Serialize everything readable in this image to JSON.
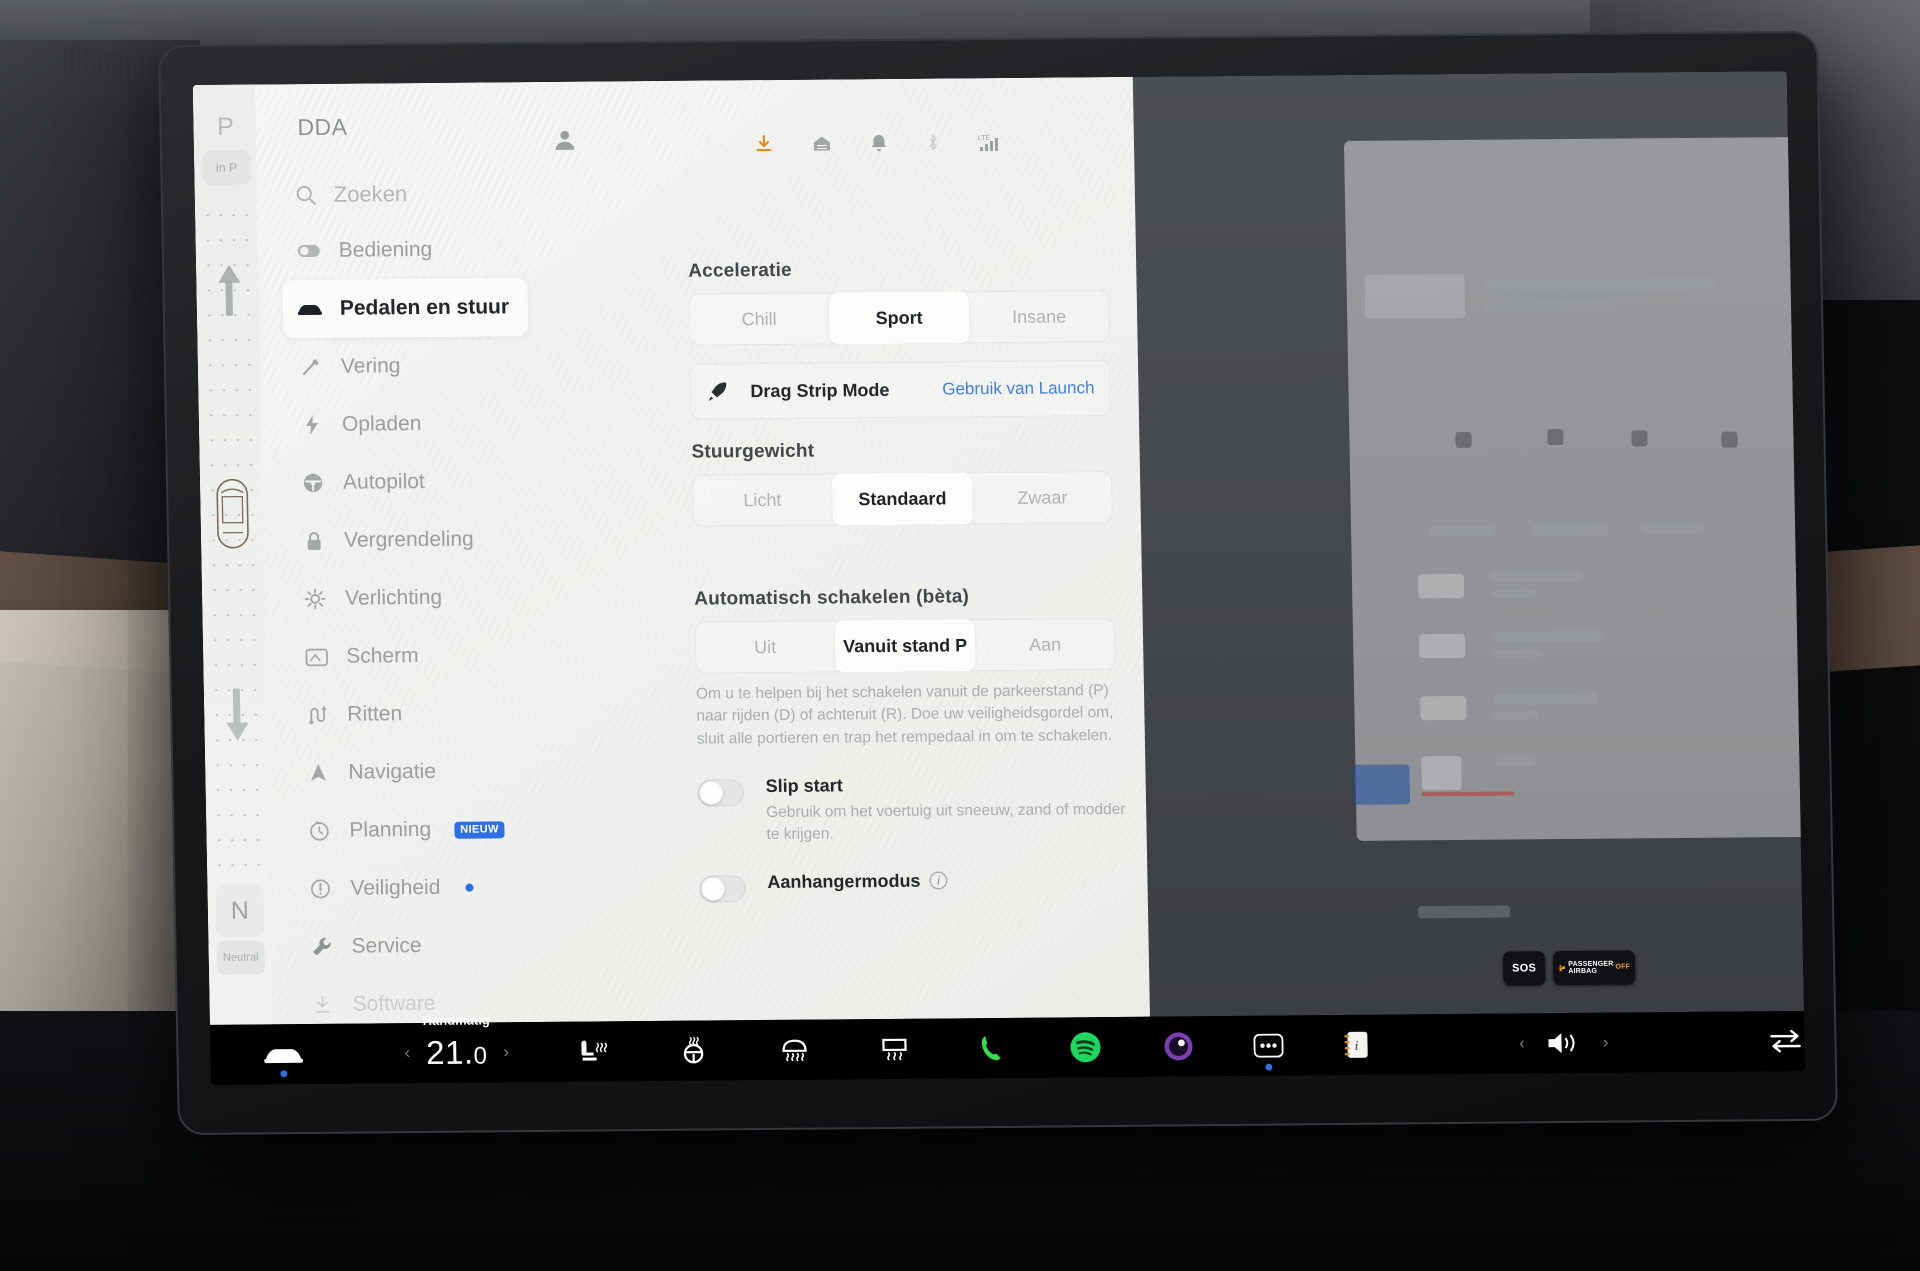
{
  "gear_selector": {
    "park_label": "P",
    "in_park_label": "In P",
    "neutral_label": "N",
    "neutral_sub_label": "Neutral"
  },
  "header": {
    "vehicle_name": "DDA",
    "profile_icon": "profile-icon",
    "status_icons": [
      "download-icon",
      "garage-icon",
      "bell-icon",
      "bluetooth-icon",
      "lte-signal-icon"
    ],
    "lte_label": "LTE"
  },
  "nav": {
    "search_placeholder": "Zoeken",
    "items": [
      {
        "label": "Bediening",
        "icon": "toggle-icon",
        "active": false
      },
      {
        "label": "Pedalen en stuur",
        "icon": "car-front-icon",
        "active": true
      },
      {
        "label": "Vering",
        "icon": "suspension-icon",
        "active": false
      },
      {
        "label": "Opladen",
        "icon": "bolt-icon",
        "active": false
      },
      {
        "label": "Autopilot",
        "icon": "steering-icon",
        "active": false
      },
      {
        "label": "Vergrendeling",
        "icon": "lock-icon",
        "active": false
      },
      {
        "label": "Verlichting",
        "icon": "sun-icon",
        "active": false
      },
      {
        "label": "Scherm",
        "icon": "display-icon",
        "active": false
      },
      {
        "label": "Ritten",
        "icon": "trips-icon",
        "active": false
      },
      {
        "label": "Navigatie",
        "icon": "navigation-icon",
        "active": false
      },
      {
        "label": "Planning",
        "icon": "clock-icon",
        "active": false,
        "badge": "NIEUW"
      },
      {
        "label": "Veiligheid",
        "icon": "alert-icon",
        "active": false,
        "dot": true
      },
      {
        "label": "Service",
        "icon": "wrench-icon",
        "active": false
      },
      {
        "label": "Software",
        "icon": "download-icon",
        "active": false
      }
    ]
  },
  "content": {
    "acceleration": {
      "title": "Acceleratie",
      "options": [
        "Chill",
        "Sport",
        "Insane"
      ],
      "selected": "Sport"
    },
    "drag_strip": {
      "icon": "rocket-icon",
      "label": "Drag Strip Mode",
      "link": "Gebruik van Launch"
    },
    "steering_weight": {
      "title": "Stuurgewicht",
      "options": [
        "Licht",
        "Standaard",
        "Zwaar"
      ],
      "selected": "Standaard"
    },
    "auto_shift": {
      "title": "Automatisch schakelen (bèta)",
      "options": [
        "Uit",
        "Vanuit stand P",
        "Aan"
      ],
      "selected": "Vanuit stand P",
      "description": "Om u te helpen bij het schakelen vanuit de parkeerstand (P) naar rijden (D) of achteruit (R). Doe uw veiligheidsgordel om, sluit alle portieren en trap het rempedaal in om te schakelen."
    },
    "toggles": [
      {
        "label": "Slip start",
        "description": "Gebruik om het voertuig uit sneeuw, zand of modder te krijgen.",
        "on": false,
        "info": false
      },
      {
        "label": "Aanhangermodus",
        "description": "",
        "on": false,
        "info": true
      }
    ]
  },
  "taskbar": {
    "car_icon": "car-icon",
    "climate": {
      "mode_label": "Handmatig",
      "temperature": "21.",
      "temperature_decimal": "0",
      "prev_icon": "chevron-left-icon",
      "next_icon": "chevron-right-icon"
    },
    "icons": [
      "seat-heater-icon",
      "steering-wheel-heater-icon",
      "rear-defrost-icon",
      "front-defrost-icon",
      "phone-icon",
      "spotify-icon",
      "camera-icon",
      "more-icon",
      "notes-icon"
    ],
    "volume": {
      "prev_icon": "chevron-left-icon",
      "speaker_icon": "volume-icon",
      "next_icon": "chevron-right-icon"
    },
    "swap_icon": "swap-icon"
  },
  "overlays": {
    "sos_label": "SOS",
    "airbag_line1": "PASSENGER",
    "airbag_line2": "AIRBAG",
    "airbag_status": "OFF"
  },
  "colors": {
    "accent_blue": "#2f6fe4",
    "link_blue": "#3f7fe0",
    "spotify_green": "#1ed760",
    "phone_green": "#31e04a",
    "download_orange": "#e08a1e",
    "panel_bg": "#f1f2ef"
  }
}
